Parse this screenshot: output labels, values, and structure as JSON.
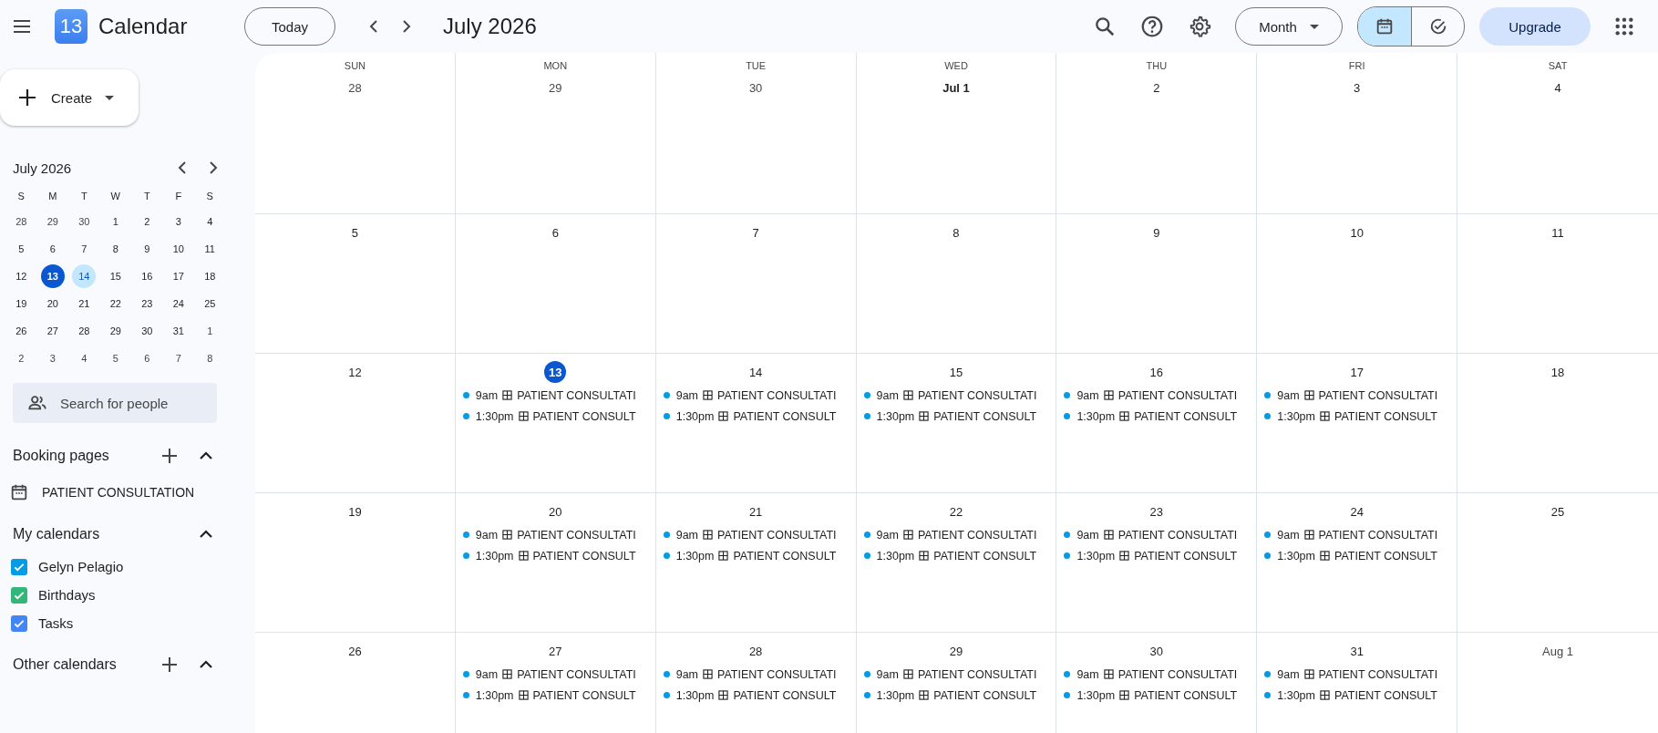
{
  "header": {
    "app_name": "Calendar",
    "logo_day": "13",
    "today_button": "Today",
    "period_title": "July 2026",
    "view_select": "Month",
    "view_toggle": [
      {
        "kind": "calendar",
        "selected": true
      },
      {
        "kind": "tasks",
        "selected": false
      }
    ],
    "upgrade_button": "Upgrade"
  },
  "sidebar": {
    "create_button": "Create",
    "mini_calendar": {
      "title": "July 2026",
      "weekdays": [
        "S",
        "M",
        "T",
        "W",
        "T",
        "F",
        "S"
      ],
      "days": [
        {
          "label": "28",
          "other_month": true,
          "today": false,
          "selected": false
        },
        {
          "label": "29",
          "other_month": true,
          "today": false,
          "selected": false
        },
        {
          "label": "30",
          "other_month": true,
          "today": false,
          "selected": false
        },
        {
          "label": "1",
          "other_month": false,
          "today": false,
          "selected": false
        },
        {
          "label": "2",
          "other_month": false,
          "today": false,
          "selected": false
        },
        {
          "label": "3",
          "other_month": false,
          "today": false,
          "selected": false
        },
        {
          "label": "4",
          "other_month": false,
          "today": false,
          "selected": false
        },
        {
          "label": "5",
          "other_month": false,
          "today": false,
          "selected": false
        },
        {
          "label": "6",
          "other_month": false,
          "today": false,
          "selected": false
        },
        {
          "label": "7",
          "other_month": false,
          "today": false,
          "selected": false
        },
        {
          "label": "8",
          "other_month": false,
          "today": false,
          "selected": false
        },
        {
          "label": "9",
          "other_month": false,
          "today": false,
          "selected": false
        },
        {
          "label": "10",
          "other_month": false,
          "today": false,
          "selected": false
        },
        {
          "label": "11",
          "other_month": false,
          "today": false,
          "selected": false
        },
        {
          "label": "12",
          "other_month": false,
          "today": false,
          "selected": false
        },
        {
          "label": "13",
          "other_month": false,
          "today": true,
          "selected": false
        },
        {
          "label": "14",
          "other_month": false,
          "today": false,
          "selected": true
        },
        {
          "label": "15",
          "other_month": false,
          "today": false,
          "selected": false
        },
        {
          "label": "16",
          "other_month": false,
          "today": false,
          "selected": false
        },
        {
          "label": "17",
          "other_month": false,
          "today": false,
          "selected": false
        },
        {
          "label": "18",
          "other_month": false,
          "today": false,
          "selected": false
        },
        {
          "label": "19",
          "other_month": false,
          "today": false,
          "selected": false
        },
        {
          "label": "20",
          "other_month": false,
          "today": false,
          "selected": false
        },
        {
          "label": "21",
          "other_month": false,
          "today": false,
          "selected": false
        },
        {
          "label": "22",
          "other_month": false,
          "today": false,
          "selected": false
        },
        {
          "label": "23",
          "other_month": false,
          "today": false,
          "selected": false
        },
        {
          "label": "24",
          "other_month": false,
          "today": false,
          "selected": false
        },
        {
          "label": "25",
          "other_month": false,
          "today": false,
          "selected": false
        },
        {
          "label": "26",
          "other_month": false,
          "today": false,
          "selected": false
        },
        {
          "label": "27",
          "other_month": false,
          "today": false,
          "selected": false
        },
        {
          "label": "28",
          "other_month": false,
          "today": false,
          "selected": false
        },
        {
          "label": "29",
          "other_month": false,
          "today": false,
          "selected": false
        },
        {
          "label": "30",
          "other_month": false,
          "today": false,
          "selected": false
        },
        {
          "label": "31",
          "other_month": false,
          "today": false,
          "selected": false
        },
        {
          "label": "1",
          "other_month": true,
          "today": false,
          "selected": false
        },
        {
          "label": "2",
          "other_month": true,
          "today": false,
          "selected": false
        },
        {
          "label": "3",
          "other_month": true,
          "today": false,
          "selected": false
        },
        {
          "label": "4",
          "other_month": true,
          "today": false,
          "selected": false
        },
        {
          "label": "5",
          "other_month": true,
          "today": false,
          "selected": false
        },
        {
          "label": "6",
          "other_month": true,
          "today": false,
          "selected": false
        },
        {
          "label": "7",
          "other_month": true,
          "today": false,
          "selected": false
        },
        {
          "label": "8",
          "other_month": true,
          "today": false,
          "selected": false
        }
      ]
    },
    "people_search": {
      "placeholder": "Search for people"
    },
    "booking_pages": {
      "title": "Booking pages",
      "items": [
        "PATIENT CONSULTATION"
      ]
    },
    "my_calendars": {
      "title": "My calendars",
      "items": [
        {
          "name": "Gelyn Pelagio",
          "checked": true,
          "color": "#039be5"
        },
        {
          "name": "Birthdays",
          "checked": true,
          "color": "#33b679"
        },
        {
          "name": "Tasks",
          "checked": true,
          "color": "#4285f4"
        }
      ]
    },
    "other_calendars": {
      "title": "Other calendars"
    }
  },
  "month_grid": {
    "weekdays": [
      "SUN",
      "MON",
      "TUE",
      "WED",
      "THU",
      "FRI",
      "SAT"
    ],
    "weeks": [
      [
        {
          "label": "28",
          "other_month": true,
          "today": false
        },
        {
          "label": "29",
          "other_month": true,
          "today": false
        },
        {
          "label": "30",
          "other_month": true,
          "today": false
        },
        {
          "label": "Jul 1",
          "other_month": false,
          "today": false
        },
        {
          "label": "2",
          "other_month": false,
          "today": false
        },
        {
          "label": "3",
          "other_month": false,
          "today": false
        },
        {
          "label": "4",
          "other_month": false,
          "today": false
        }
      ],
      [
        {
          "label": "5",
          "other_month": false,
          "today": false
        },
        {
          "label": "6",
          "other_month": false,
          "today": false
        },
        {
          "label": "7",
          "other_month": false,
          "today": false
        },
        {
          "label": "8",
          "other_month": false,
          "today": false
        },
        {
          "label": "9",
          "other_month": false,
          "today": false
        },
        {
          "label": "10",
          "other_month": false,
          "today": false
        },
        {
          "label": "11",
          "other_month": false,
          "today": false
        }
      ],
      [
        {
          "label": "12",
          "other_month": false,
          "today": false
        },
        {
          "label": "13",
          "other_month": false,
          "today": true,
          "events": [
            {
              "time": "9am",
              "title": "PATIENT CONSULTATI"
            },
            {
              "time": "1:30pm",
              "title": "PATIENT CONSULT"
            }
          ]
        },
        {
          "label": "14",
          "other_month": false,
          "today": false,
          "events": [
            {
              "time": "9am",
              "title": "PATIENT CONSULTATI"
            },
            {
              "time": "1:30pm",
              "title": "PATIENT CONSULT"
            }
          ]
        },
        {
          "label": "15",
          "other_month": false,
          "today": false,
          "events": [
            {
              "time": "9am",
              "title": "PATIENT CONSULTATI"
            },
            {
              "time": "1:30pm",
              "title": "PATIENT CONSULT"
            }
          ]
        },
        {
          "label": "16",
          "other_month": false,
          "today": false,
          "events": [
            {
              "time": "9am",
              "title": "PATIENT CONSULTATI"
            },
            {
              "time": "1:30pm",
              "title": "PATIENT CONSULT"
            }
          ]
        },
        {
          "label": "17",
          "other_month": false,
          "today": false,
          "events": [
            {
              "time": "9am",
              "title": "PATIENT CONSULTATI"
            },
            {
              "time": "1:30pm",
              "title": "PATIENT CONSULT"
            }
          ]
        },
        {
          "label": "18",
          "other_month": false,
          "today": false
        }
      ],
      [
        {
          "label": "19",
          "other_month": false,
          "today": false
        },
        {
          "label": "20",
          "other_month": false,
          "today": false,
          "events": [
            {
              "time": "9am",
              "title": "PATIENT CONSULTATI"
            },
            {
              "time": "1:30pm",
              "title": "PATIENT CONSULT"
            }
          ]
        },
        {
          "label": "21",
          "other_month": false,
          "today": false,
          "events": [
            {
              "time": "9am",
              "title": "PATIENT CONSULTATI"
            },
            {
              "time": "1:30pm",
              "title": "PATIENT CONSULT"
            }
          ]
        },
        {
          "label": "22",
          "other_month": false,
          "today": false,
          "events": [
            {
              "time": "9am",
              "title": "PATIENT CONSULTATI"
            },
            {
              "time": "1:30pm",
              "title": "PATIENT CONSULT"
            }
          ]
        },
        {
          "label": "23",
          "other_month": false,
          "today": false,
          "events": [
            {
              "time": "9am",
              "title": "PATIENT CONSULTATI"
            },
            {
              "time": "1:30pm",
              "title": "PATIENT CONSULT"
            }
          ]
        },
        {
          "label": "24",
          "other_month": false,
          "today": false,
          "events": [
            {
              "time": "9am",
              "title": "PATIENT CONSULTATI"
            },
            {
              "time": "1:30pm",
              "title": "PATIENT CONSULT"
            }
          ]
        },
        {
          "label": "25",
          "other_month": false,
          "today": false
        }
      ],
      [
        {
          "label": "26",
          "other_month": false,
          "today": false
        },
        {
          "label": "27",
          "other_month": false,
          "today": false,
          "events": [
            {
              "time": "9am",
              "title": "PATIENT CONSULTATI"
            },
            {
              "time": "1:30pm",
              "title": "PATIENT CONSULT"
            }
          ]
        },
        {
          "label": "28",
          "other_month": false,
          "today": false,
          "events": [
            {
              "time": "9am",
              "title": "PATIENT CONSULTATI"
            },
            {
              "time": "1:30pm",
              "title": "PATIENT CONSULT"
            }
          ]
        },
        {
          "label": "29",
          "other_month": false,
          "today": false,
          "events": [
            {
              "time": "9am",
              "title": "PATIENT CONSULTATI"
            },
            {
              "time": "1:30pm",
              "title": "PATIENT CONSULT"
            }
          ]
        },
        {
          "label": "30",
          "other_month": false,
          "today": false,
          "events": [
            {
              "time": "9am",
              "title": "PATIENT CONSULTATI"
            },
            {
              "time": "1:30pm",
              "title": "PATIENT CONSULT"
            }
          ]
        },
        {
          "label": "31",
          "other_month": false,
          "today": false,
          "events": [
            {
              "time": "9am",
              "title": "PATIENT CONSULTATI"
            },
            {
              "time": "1:30pm",
              "title": "PATIENT CONSULT"
            }
          ]
        },
        {
          "label": "Aug 1",
          "other_month": true,
          "today": false
        }
      ]
    ]
  }
}
